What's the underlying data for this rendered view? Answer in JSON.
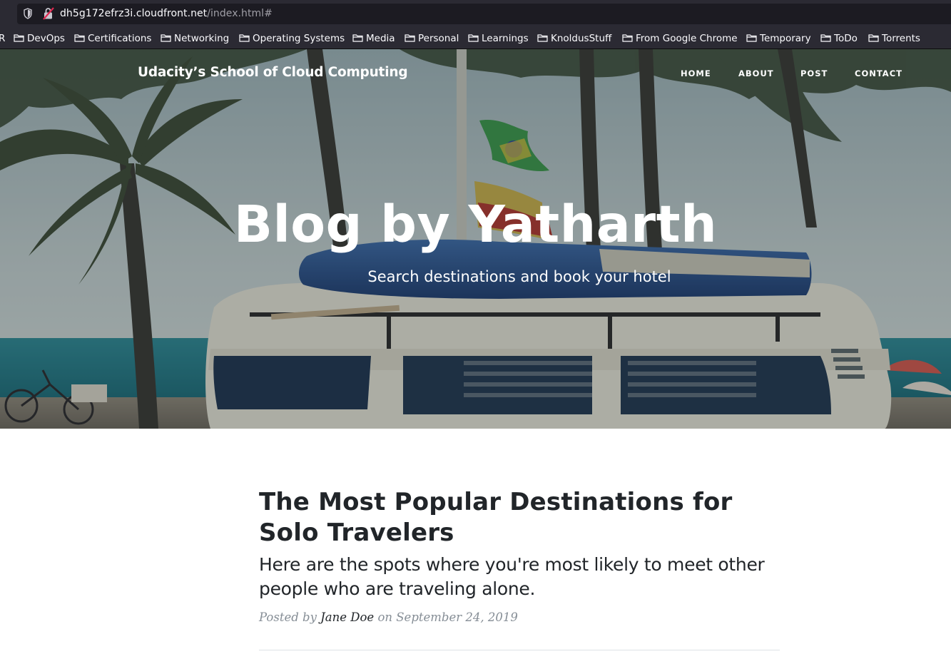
{
  "browser": {
    "url_host": "dh5g172efrz3i.cloudfront.net",
    "url_path": "/index.html#",
    "bookmarks": [
      {
        "label": "R",
        "folder": false
      },
      {
        "label": "DevOps",
        "folder": true
      },
      {
        "label": "Certifications",
        "folder": true
      },
      {
        "label": "Networking",
        "folder": true
      },
      {
        "label": "Operating Systems",
        "folder": true
      },
      {
        "label": "Media",
        "folder": true
      },
      {
        "label": "Personal",
        "folder": true
      },
      {
        "label": "Learnings",
        "folder": true
      },
      {
        "label": "KnoldusStuff",
        "folder": true
      },
      {
        "label": "From Google Chrome",
        "folder": true
      },
      {
        "label": "Temporary",
        "folder": true
      },
      {
        "label": "ToDo",
        "folder": true
      },
      {
        "label": "Torrents",
        "folder": true
      }
    ]
  },
  "site": {
    "brand": "Udacity’s School of Cloud Computing",
    "nav": [
      {
        "label": "HOME"
      },
      {
        "label": "ABOUT"
      },
      {
        "label": "POST"
      },
      {
        "label": "CONTACT"
      }
    ]
  },
  "hero": {
    "title": "Blog by Yatharth",
    "subtitle": "Search destinations and book your hotel"
  },
  "post": {
    "title": "The Most Popular Destinations for Solo Travelers",
    "subtitle": "Here are the spots where you're most likely to meet other people who are traveling alone.",
    "meta_prefix": "Posted by",
    "author": "Jane Doe",
    "meta_on": "on",
    "date": "September 24, 2019"
  },
  "colors": {
    "chrome_bg": "#2b2a33",
    "text_dark": "#212529",
    "meta_gray": "#868e96"
  }
}
